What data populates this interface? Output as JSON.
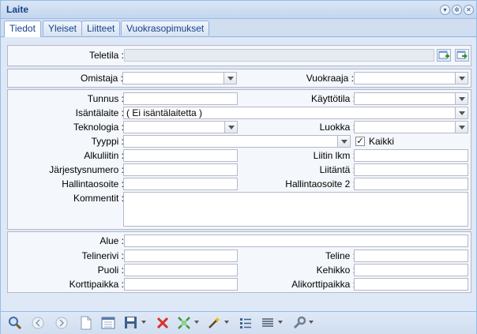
{
  "window": {
    "title": "Laite"
  },
  "tabs": [
    {
      "label": "Tiedot",
      "active": true
    },
    {
      "label": "Yleiset",
      "active": false
    },
    {
      "label": "Liitteet",
      "active": false
    },
    {
      "label": "Vuokrasopimukset",
      "active": false
    }
  ],
  "fields": {
    "teletila": {
      "label": "Teletila :",
      "value": ""
    },
    "omistaja": {
      "label": "Omistaja :",
      "value": ""
    },
    "vuokraaja": {
      "label": "Vuokraaja :",
      "value": ""
    },
    "tunnus": {
      "label": "Tunnus :",
      "value": ""
    },
    "kayttotila": {
      "label": "Käyttötila :",
      "value": ""
    },
    "isantalaite": {
      "label": "Isäntälaite :",
      "value": "( Ei isäntälaitetta )"
    },
    "teknologia": {
      "label": "Teknologia :",
      "value": ""
    },
    "luokka": {
      "label": "Luokka :",
      "value": ""
    },
    "tyyppi": {
      "label": "Tyyppi :",
      "value": ""
    },
    "kaikki": {
      "label": "Kaikki",
      "checked": true
    },
    "alkuliitin": {
      "label": "Alkuliitin :",
      "value": ""
    },
    "liitin_lkm": {
      "label": "Liitin lkm :",
      "value": ""
    },
    "jarjestysnumero": {
      "label": "Järjestysnumero :",
      "value": ""
    },
    "liitanta": {
      "label": "Liitäntä :",
      "value": ""
    },
    "hallintaosoite": {
      "label": "Hallintaosoite :",
      "value": ""
    },
    "hallintaosoite2": {
      "label": "Hallintaosoite 2 :",
      "value": ""
    },
    "kommentit": {
      "label": "Kommentit :",
      "value": ""
    },
    "alue": {
      "label": "Alue :",
      "value": ""
    },
    "telinerivi": {
      "label": "Telinerivi :",
      "value": ""
    },
    "teline": {
      "label": "Teline :",
      "value": ""
    },
    "puoli": {
      "label": "Puoli :",
      "value": ""
    },
    "kehikko": {
      "label": "Kehikko :",
      "value": ""
    },
    "korttipaikka": {
      "label": "Korttipaikka :",
      "value": ""
    },
    "alikorttipaikka": {
      "label": "Alikorttipaikka :",
      "value": ""
    }
  },
  "icons": {
    "header_tools": [
      "collapse-icon",
      "gear-icon",
      "close-icon"
    ],
    "toolbar": [
      "search-icon",
      "prev-icon",
      "next-icon",
      "new-document-icon",
      "form-view-icon",
      "save-icon",
      "delete-icon",
      "move-icon",
      "wand-icon",
      "list-icon",
      "table-icon",
      "wrench-icon"
    ]
  }
}
